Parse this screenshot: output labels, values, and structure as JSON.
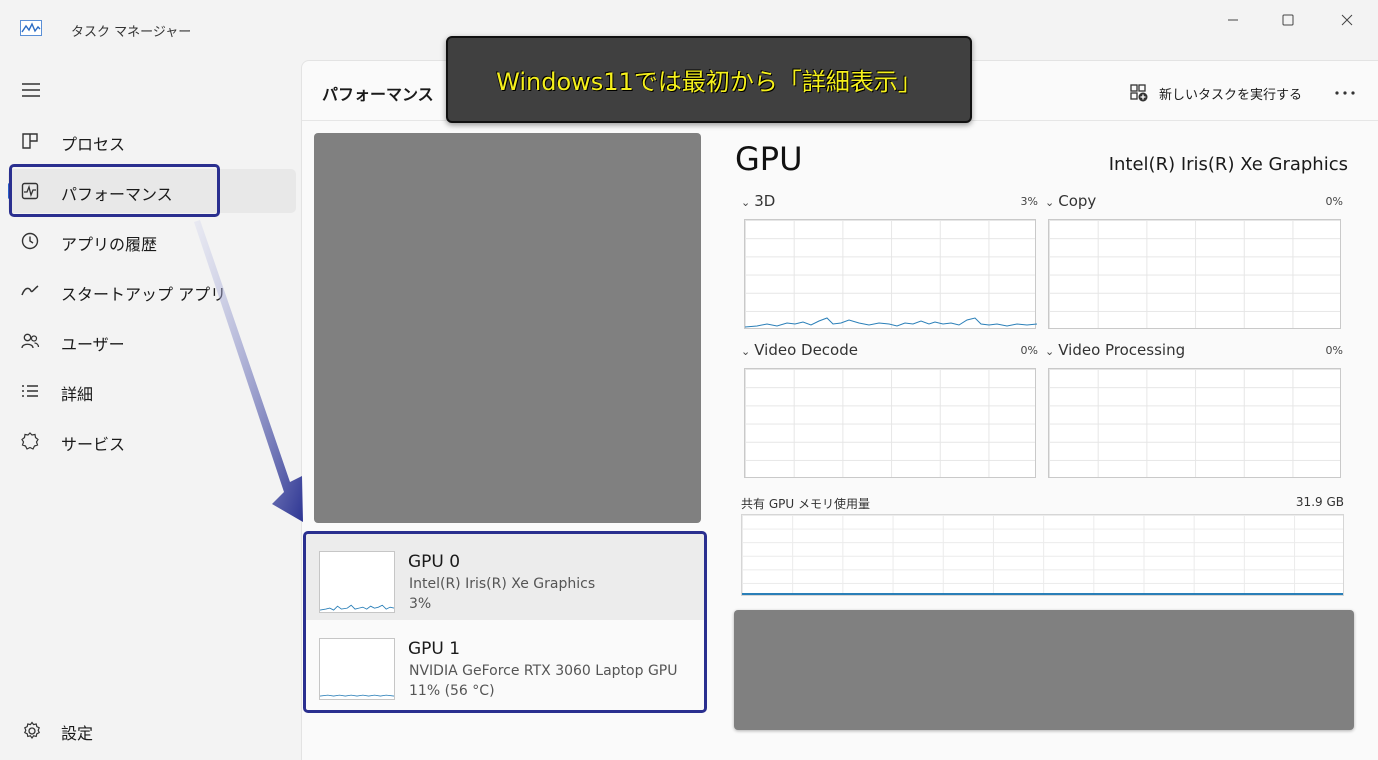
{
  "window": {
    "title": "タスク マネージャー",
    "minimize_icon": "minimize-icon",
    "maximize_icon": "maximize-icon",
    "close_icon": "close-icon"
  },
  "sidebar": {
    "menu_icon": "hamburger-icon",
    "items": [
      {
        "label": "プロセス",
        "icon": "processes-icon"
      },
      {
        "label": "パフォーマンス",
        "icon": "performance-icon",
        "active": true
      },
      {
        "label": "アプリの履歴",
        "icon": "history-icon"
      },
      {
        "label": "スタートアップ アプリ",
        "icon": "startup-icon"
      },
      {
        "label": "ユーザー",
        "icon": "users-icon"
      },
      {
        "label": "詳細",
        "icon": "details-icon"
      },
      {
        "label": "サービス",
        "icon": "services-icon"
      }
    ],
    "settings_label": "設定"
  },
  "header": {
    "title": "パフォーマンス",
    "run_task_label": "新しいタスクを実行する",
    "more_icon": "more-icon"
  },
  "callout": {
    "text": "Windows11では最初から「詳細表示」"
  },
  "gpu_list": [
    {
      "name": "GPU 0",
      "model": "Intel(R) Iris(R) Xe Graphics",
      "util": "3%"
    },
    {
      "name": "GPU 1",
      "model": "NVIDIA GeForce RTX 3060 Laptop GPU",
      "util": "11% (56 °C)"
    }
  ],
  "detail": {
    "heading": "GPU",
    "full_name": "Intel(R) Iris(R) Xe Graphics",
    "engines": [
      {
        "label": "3D",
        "pct": "3%"
      },
      {
        "label": "Copy",
        "pct": "0%"
      },
      {
        "label": "Video Decode",
        "pct": "0%"
      },
      {
        "label": "Video Processing",
        "pct": "0%"
      }
    ],
    "shared_memory_label": "共有 GPU メモリ使用量",
    "shared_memory_value": "31.9 GB"
  },
  "colors": {
    "accent": "#2b60c9",
    "highlight_border": "#2a2f8f",
    "callout_text": "#f5f01c",
    "graph_line": "#2a7fb8"
  }
}
